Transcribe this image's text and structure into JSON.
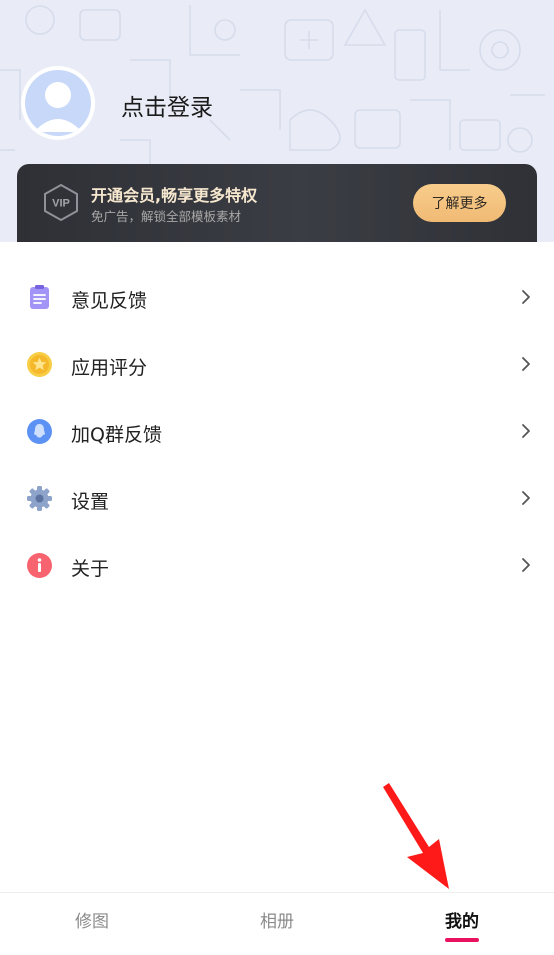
{
  "profile": {
    "login_label": "点击登录",
    "avatar_icon": "user-avatar-icon"
  },
  "vip": {
    "badge_text": "VIP",
    "title": "开通会员,畅享更多特权",
    "subtitle": "免广告，解锁全部模板素材",
    "button_label": "了解更多"
  },
  "menu": {
    "items": [
      {
        "label": "意见反馈",
        "icon": "clipboard-icon",
        "color": "#8e7cf0"
      },
      {
        "label": "应用评分",
        "icon": "star-icon",
        "color": "#f5c133"
      },
      {
        "label": "加Q群反馈",
        "icon": "qq-penguin-icon",
        "color": "#5d92f5"
      },
      {
        "label": "设置",
        "icon": "gear-icon",
        "color": "#8ea3c9"
      },
      {
        "label": "关于",
        "icon": "info-icon",
        "color": "#f76470"
      }
    ]
  },
  "bottom_nav": {
    "tabs": [
      {
        "label": "修图",
        "active": false
      },
      {
        "label": "相册",
        "active": false
      },
      {
        "label": "我的",
        "active": true
      }
    ],
    "active_color": "#e8125f"
  },
  "colors": {
    "header_bg": "#e9ecf6",
    "banner_bg": "#2e3036",
    "banner_title": "#f6e7cf",
    "button_gold": "#f4c27d",
    "annotation_arrow": "#ff1a1a"
  }
}
